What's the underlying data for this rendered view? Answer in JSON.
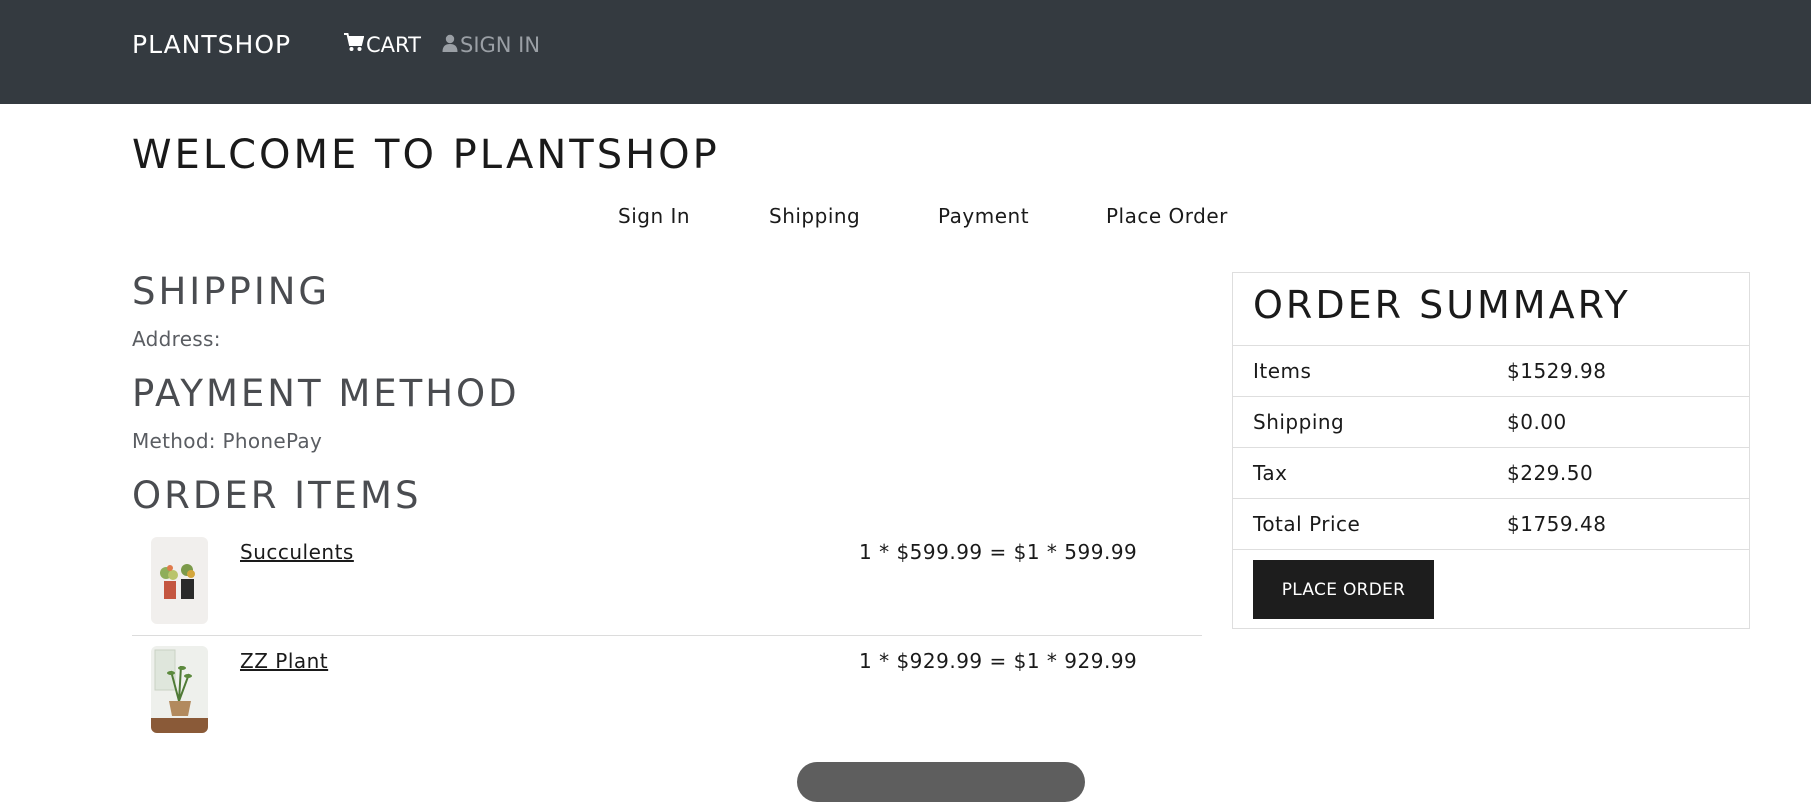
{
  "header": {
    "brand": "PLANTSHOP",
    "cart_label": "CART",
    "signin_label": "SIGN IN"
  },
  "page": {
    "welcome": "WELCOME TO PLANTSHOP"
  },
  "steps": [
    "Sign In",
    "Shipping",
    "Payment",
    "Place Order"
  ],
  "shipping": {
    "title": "SHIPPING",
    "address": "Address:"
  },
  "payment": {
    "title": "PAYMENT METHOD",
    "method": "Method: PhonePay"
  },
  "order_items": {
    "title": "ORDER ITEMS",
    "items": [
      {
        "name": "Succulents",
        "price_line": "1 * $599.99 = $1 * 599.99",
        "image": "succulents-thumbnail"
      },
      {
        "name": "ZZ Plant",
        "price_line": "1 * $929.99 = $1 * 929.99",
        "image": "zz-plant-thumbnail"
      }
    ]
  },
  "summary": {
    "title": "ORDER SUMMARY",
    "rows": [
      {
        "label": "Items",
        "value": "$1529.98"
      },
      {
        "label": "Shipping",
        "value": "$0.00"
      },
      {
        "label": "Tax",
        "value": "$229.50"
      },
      {
        "label": "Total Price",
        "value": "$1759.48"
      }
    ],
    "button": "PLACE ORDER"
  },
  "icons": {
    "cart": "cart-icon",
    "user": "user-icon"
  },
  "colors": {
    "navbar": "#343a40",
    "button": "#1d1d1d",
    "muted_nav": "#9a9fa5"
  }
}
